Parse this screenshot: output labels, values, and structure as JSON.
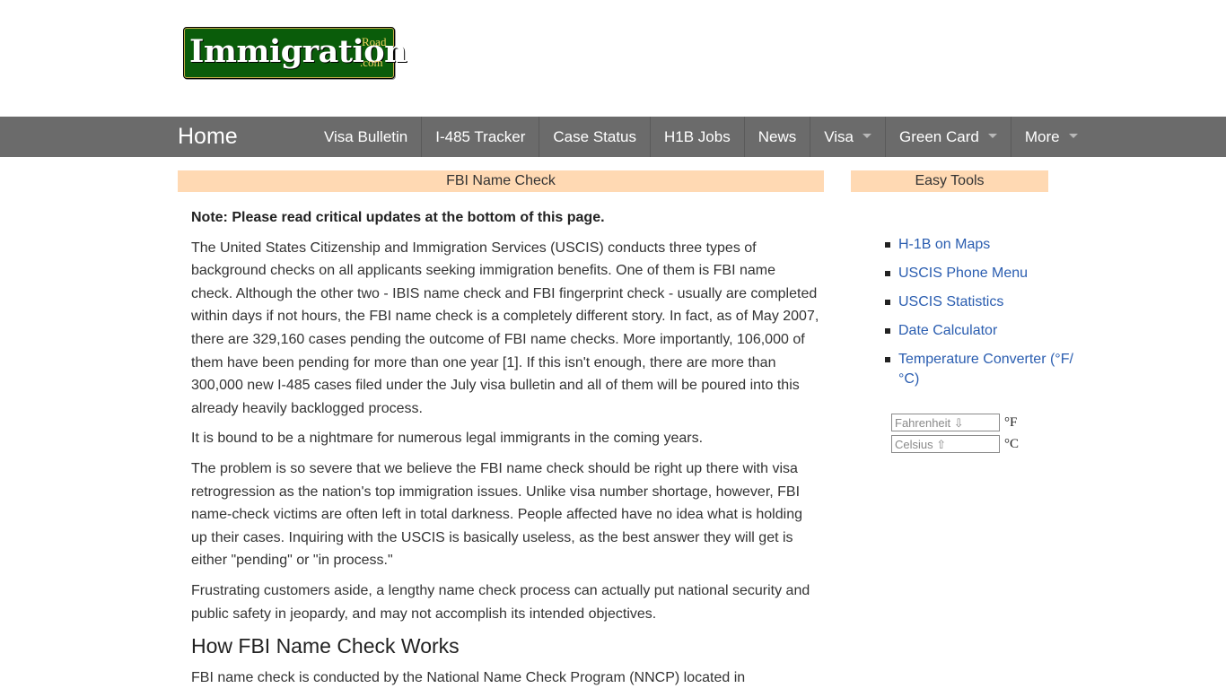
{
  "header": {
    "logo_main": "Immigration",
    "logo_road": "Road",
    "logo_com": ".com"
  },
  "nav": {
    "home": "Home",
    "items": [
      {
        "label": "Visa Bulletin",
        "has_dropdown": false
      },
      {
        "label": "I-485 Tracker",
        "has_dropdown": false
      },
      {
        "label": "Case Status",
        "has_dropdown": false
      },
      {
        "label": "H1B Jobs",
        "has_dropdown": false
      },
      {
        "label": "News",
        "has_dropdown": false
      },
      {
        "label": "Visa",
        "has_dropdown": true
      },
      {
        "label": "Green Card",
        "has_dropdown": true
      },
      {
        "label": "More",
        "has_dropdown": true
      }
    ]
  },
  "main": {
    "section_title": "FBI Name Check",
    "note": "Note: Please read critical updates at the bottom of this page.",
    "p1_before_ref": "The United States Citizenship and Immigration Services (USCIS) conducts three types of background checks on all applicants seeking immigration benefits. One of them is FBI name check. Although the other two - IBIS name check and FBI fingerprint check - usually are completed within days if not hours, the FBI name check is a completely different story. In fact, as of May 2007, there are 329,160 cases pending the outcome of FBI name checks. More importantly, 106,000 of them have been pending for more than one year ",
    "p1_ref": "[1]",
    "p1_after_ref": ". If this isn't enough, there are more than 300,000 new I-485 cases filed under the July visa bulletin and all of them will be poured into this already heavily backlogged process.",
    "p2": "It is bound to be a nightmare for numerous legal immigrants in the coming years.",
    "p3": "The problem is so severe that we believe the FBI name check should be right up there with visa retrogression as the nation's top immigration issues. Unlike visa number shortage, however, FBI name-check victims are often left in total darkness. People affected have no idea what is holding up their cases. Inquiring with the USCIS is basically useless, as the best answer they will get is either \"pending\" or \"in process.\"",
    "p4": "Frustrating customers aside, a lengthy name check process can actually put national security and public safety in jeopardy, and may not accomplish its intended objectives.",
    "h2": "How FBI Name Check Works",
    "p5": "FBI name check is conducted by the National Name Check Program (NNCP) located in"
  },
  "sidebar": {
    "title": "Easy Tools",
    "links": [
      "H-1B on Maps",
      "USCIS Phone Menu",
      "USCIS Statistics",
      "Date Calculator",
      "Temperature Converter (°F/°C)"
    ],
    "converter": {
      "fahrenheit_placeholder": "Fahrenheit ⇩",
      "fahrenheit_unit": "°F",
      "celsius_placeholder": "Celsius ⇧",
      "celsius_unit": "°C"
    }
  },
  "colors": {
    "nav_bg": "#6b6b6b",
    "section_bar_bg": "#ffd9b3",
    "link": "#2a5db0",
    "logo_bg": "#0a5c0a"
  }
}
